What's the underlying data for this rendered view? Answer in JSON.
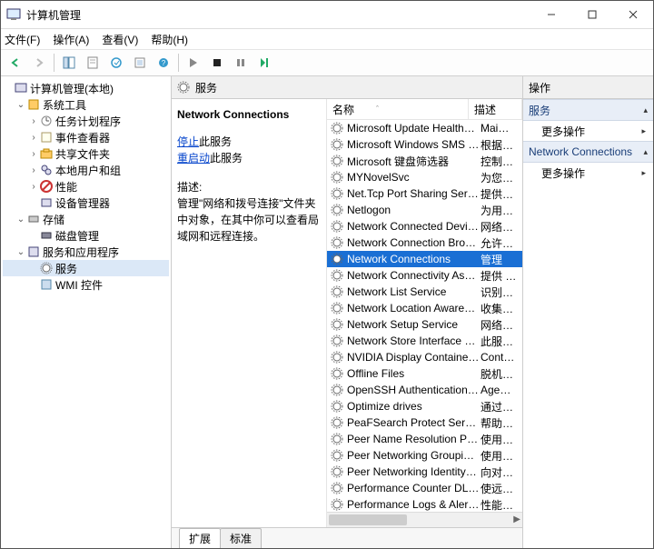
{
  "title": "计算机管理",
  "menus": [
    "文件(F)",
    "操作(A)",
    "查看(V)",
    "帮助(H)"
  ],
  "tree": {
    "root": "计算机管理(本地)",
    "sys": "系统工具",
    "sys_items": [
      "任务计划程序",
      "事件查看器",
      "共享文件夹",
      "本地用户和组",
      "性能",
      "设备管理器"
    ],
    "storage": "存储",
    "storage_items": [
      "磁盘管理"
    ],
    "apps": "服务和应用程序",
    "apps_items": [
      "服务",
      "WMI 控件"
    ]
  },
  "center": {
    "header": "服务",
    "svc_name": "Network Connections",
    "stop_prefix": "停止",
    "stop_suffix": "此服务",
    "restart_prefix": "重启动",
    "restart_suffix": "此服务",
    "desc_label": "描述:",
    "desc_body": "管理\"网络和拨号连接\"文件夹中对象，在其中你可以查看局域网和远程连接。",
    "col_name": "名称",
    "col_desc": "描述",
    "tabs": [
      "扩展",
      "标准"
    ]
  },
  "rows": [
    {
      "n": "Microsoft Update Health…",
      "d": "Mai…"
    },
    {
      "n": "Microsoft Windows SMS …",
      "d": "根据…"
    },
    {
      "n": "Microsoft 键盘筛选器",
      "d": "控制…"
    },
    {
      "n": "MYNovelSvc",
      "d": "为您…"
    },
    {
      "n": "Net.Tcp Port Sharing Ser…",
      "d": "提供…"
    },
    {
      "n": "Netlogon",
      "d": "为用…"
    },
    {
      "n": "Network Connected Devi…",
      "d": "网络…"
    },
    {
      "n": "Network Connection Bro…",
      "d": "允许…"
    },
    {
      "n": "Network Connections",
      "d": "管理",
      "sel": true
    },
    {
      "n": "Network Connectivity Ass…",
      "d": "提供 …"
    },
    {
      "n": "Network List Service",
      "d": "识别…"
    },
    {
      "n": "Network Location Aware…",
      "d": "收集…"
    },
    {
      "n": "Network Setup Service",
      "d": "网络…"
    },
    {
      "n": "Network Store Interface …",
      "d": "此服…"
    },
    {
      "n": "NVIDIA Display Containe…",
      "d": "Cont…"
    },
    {
      "n": "Offline Files",
      "d": "脱机…"
    },
    {
      "n": "OpenSSH Authentication …",
      "d": "Age…"
    },
    {
      "n": "Optimize drives",
      "d": "通过…"
    },
    {
      "n": "PeaFSearch Protect Service",
      "d": "帮助…"
    },
    {
      "n": "Peer Name Resolution Pr…",
      "d": "使用…"
    },
    {
      "n": "Peer Networking Groupi…",
      "d": "使用…"
    },
    {
      "n": "Peer Networking Identity…",
      "d": "向对…"
    },
    {
      "n": "Performance Counter DL…",
      "d": "使远…"
    },
    {
      "n": "Performance Logs & Aler…",
      "d": "性能…"
    }
  ],
  "actions": {
    "header": "操作",
    "sec1": "服务",
    "more": "更多操作",
    "sec2": "Network Connections"
  }
}
